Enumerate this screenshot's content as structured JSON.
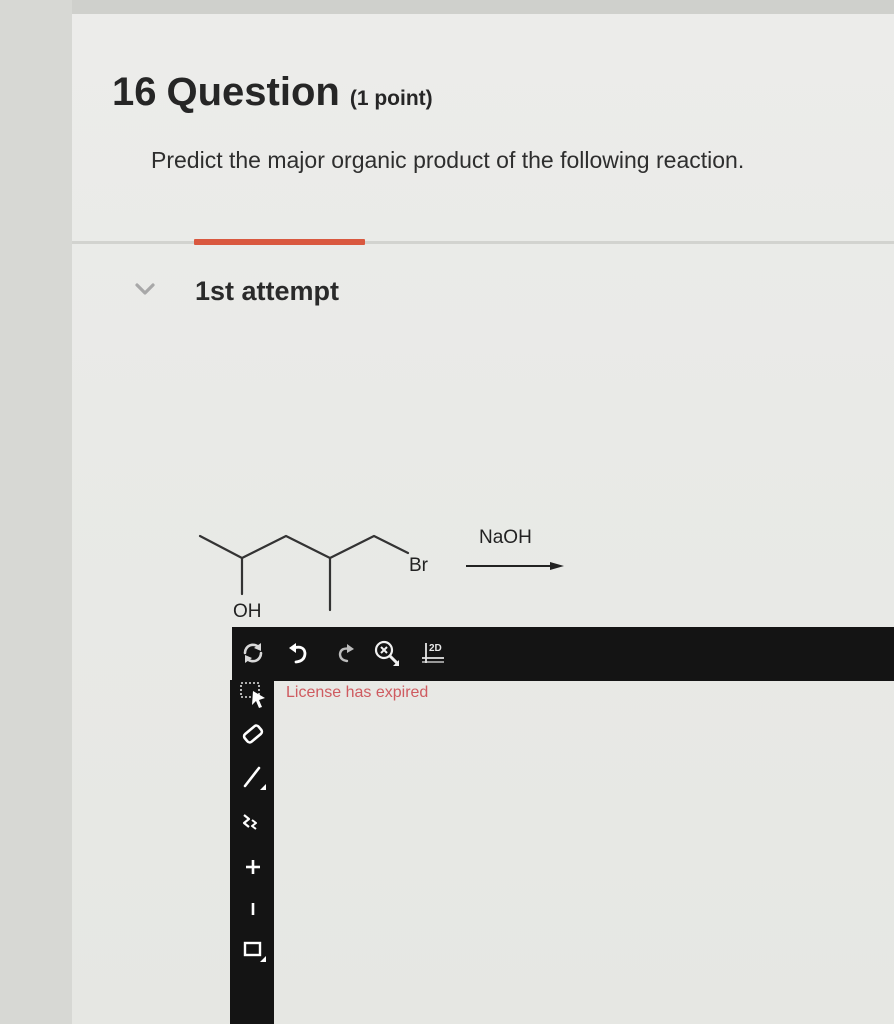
{
  "question": {
    "number": "16",
    "title": "Question",
    "points": "(1 point)",
    "prompt": "Predict the major organic product of the following reaction."
  },
  "attempt": {
    "label": "1st attempt"
  },
  "reaction": {
    "leaving_group": "Br",
    "hydroxyl": "OH",
    "reagent": "NaOH"
  },
  "editor": {
    "toolbar": [
      "refresh-icon",
      "undo-icon",
      "redo-icon",
      "zoom-clear-icon",
      "2d-clean-icon"
    ],
    "toolbar_2d_label": "2D",
    "tools": [
      "select-icon",
      "eraser-icon",
      "bond-icon",
      "chain-icon",
      "charge-plus-icon",
      "charge-minus-icon",
      "ring-icon"
    ],
    "license_message": "License has expired",
    "colors": {
      "toolbar_bg": "#141414",
      "accent": "#d9583f",
      "license_text": "#cf5b60"
    }
  }
}
